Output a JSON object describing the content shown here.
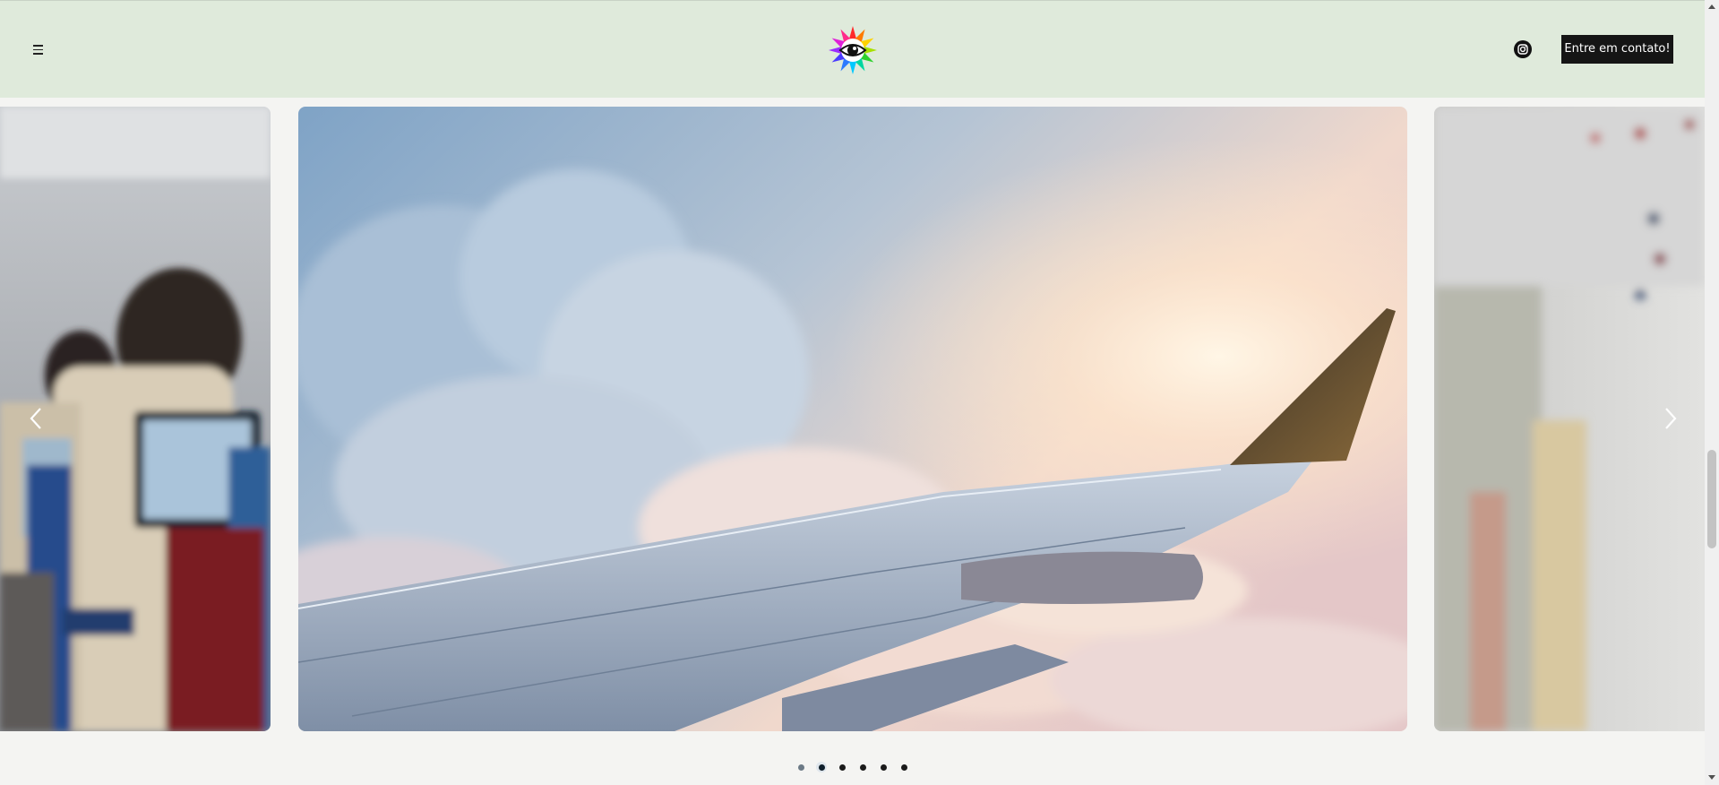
{
  "header": {
    "menu_icon": "hamburger-icon",
    "logo_icon": "rainbow-eye-logo",
    "instagram_icon": "instagram-icon",
    "contact_label": "Entre em contato!",
    "colors": {
      "background": "#dfeadb",
      "button": "#151515"
    }
  },
  "carousel": {
    "prev_icon": "chevron-left-icon",
    "next_icon": "chevron-right-icon",
    "slides": [
      {
        "id": "slide-airplane-cabin",
        "description_icon": "photo-airplane-cabin"
      },
      {
        "id": "slide-airplane-wing",
        "description_icon": "photo-airplane-wing"
      },
      {
        "id": "slide-map-pins",
        "description_icon": "photo-map-pins"
      }
    ],
    "dots": {
      "count": 6,
      "active_index": 1
    }
  }
}
